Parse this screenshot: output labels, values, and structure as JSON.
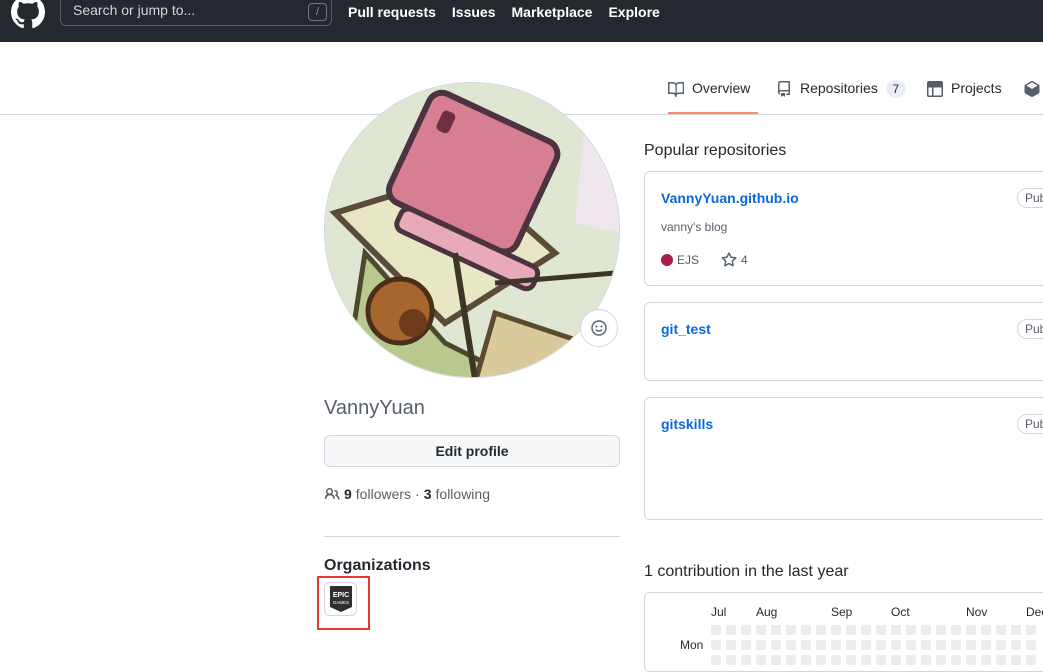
{
  "header": {
    "search_placeholder": "Search or jump to...",
    "search_shortcut": "/",
    "nav": [
      "Pull requests",
      "Issues",
      "Marketplace",
      "Explore"
    ]
  },
  "tabs": {
    "overview": "Overview",
    "repositories": "Repositories",
    "repositories_count": "7",
    "projects": "Projects"
  },
  "profile": {
    "username": "VannyYuan",
    "edit_button": "Edit profile",
    "followers_count": "9",
    "followers_label": "followers",
    "separator": "·",
    "following_count": "3",
    "following_label": "following"
  },
  "organizations": {
    "title": "Organizations",
    "logo_text": "EPIC GAMES"
  },
  "popular": {
    "title": "Popular repositories",
    "repos": [
      {
        "name": "VannyYuan.github.io",
        "badge": "Pub",
        "description": "vanny's blog",
        "language": "EJS",
        "language_color": "#a91e50",
        "stars": "4"
      },
      {
        "name": "git_test",
        "badge": "Pub"
      },
      {
        "name": "gitskills",
        "badge": "Pub"
      }
    ]
  },
  "contributions": {
    "title": "1 contribution in the last year",
    "months": [
      "Jul",
      "Aug",
      "Sep",
      "Oct",
      "Nov",
      "Dec"
    ],
    "day_label": "Mon"
  },
  "colors": {
    "header_bg": "#24292f",
    "link": "#0969da",
    "active_tab": "#fd8c73",
    "highlight": "#e53935"
  }
}
